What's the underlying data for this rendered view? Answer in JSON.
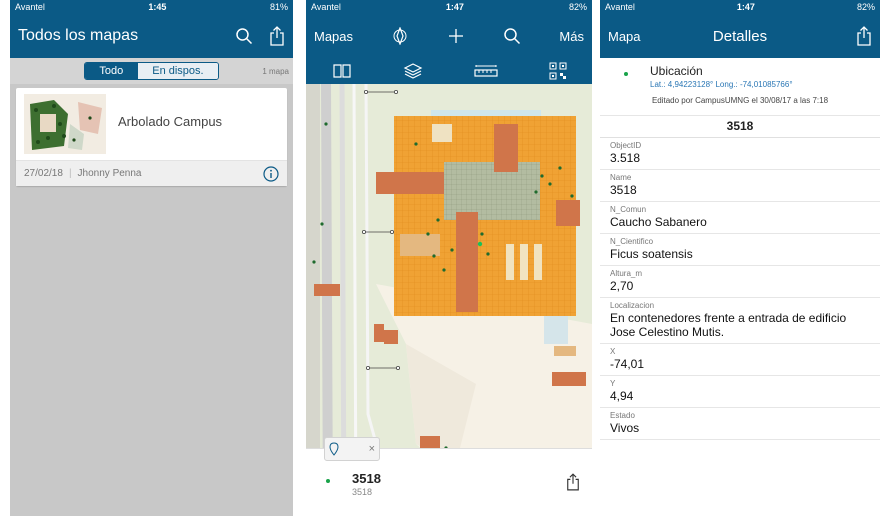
{
  "panel1": {
    "status": {
      "carrier": "Avantel",
      "time": "1:45",
      "battery": "81%"
    },
    "nav": {
      "title": "Todos los mapas"
    },
    "segment": {
      "all": "Todo",
      "available": "En dispos.",
      "count": "1 mapa"
    },
    "card": {
      "title": "Arbolado Campus",
      "date": "27/02/18",
      "author": "Jhonny Penna"
    }
  },
  "panel2": {
    "status": {
      "carrier": "Avantel",
      "time": "1:47",
      "battery": "82%"
    },
    "nav": {
      "left": "Mapas",
      "right": "Más"
    },
    "popup": {
      "title": "3518",
      "subtitle": "3518",
      "close": "×"
    }
  },
  "panel3": {
    "status": {
      "carrier": "Avantel",
      "time": "1:47",
      "battery": "82%"
    },
    "nav": {
      "back": "Mapa",
      "title": "Detalles"
    },
    "location": {
      "name": "Ubicación",
      "coords": "Lat.: 4,94223128° Long.: -74,01085766°",
      "edited": "Editado por CampusUMNG el 30/08/17 a las 7:18"
    },
    "record_id": "3518",
    "fields": [
      {
        "label": "ObjectID",
        "value": "3.518"
      },
      {
        "label": "Name",
        "value": "3518"
      },
      {
        "label": "N_Comun",
        "value": "Caucho Sabanero"
      },
      {
        "label": "N_Cientifico",
        "value": "Ficus soatensis"
      },
      {
        "label": "Altura_m",
        "value": "2,70"
      },
      {
        "label": "Localizacion",
        "value": "En contenedores frente a entrada de edificio Jose Celestino Mutis."
      },
      {
        "label": "X",
        "value": "-74,01"
      },
      {
        "label": "Y",
        "value": "4,94"
      },
      {
        "label": "Estado",
        "value": "Vivos"
      }
    ]
  },
  "colors": {
    "nav": "#0b5a86",
    "building": "#f0a234",
    "roof": "#c98a5a",
    "plaza": "#a9b494",
    "point": "#19a34a"
  },
  "icons": [
    "search-icon",
    "share-icon",
    "compass-icon",
    "add-icon",
    "book-icon",
    "layers-icon",
    "measure-icon",
    "qr-icon",
    "info-icon",
    "pin-icon"
  ]
}
